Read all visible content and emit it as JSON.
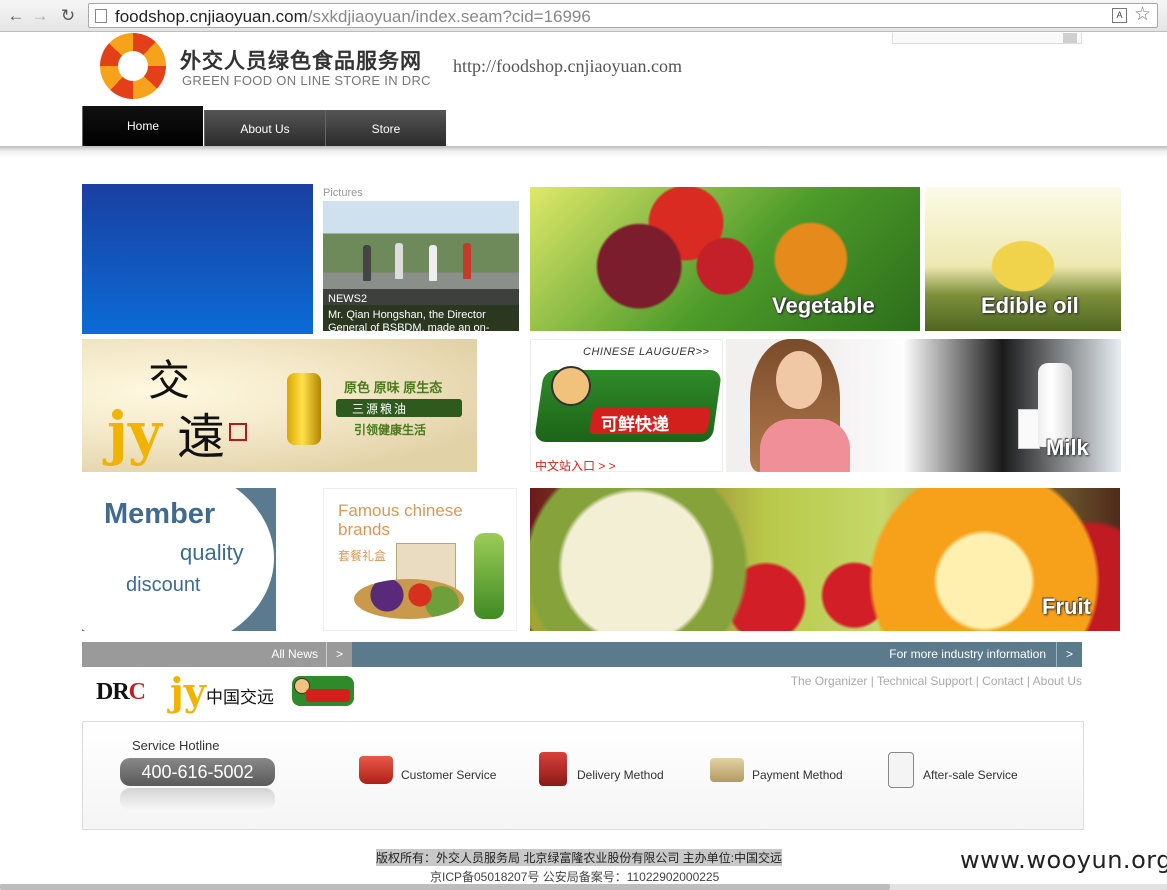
{
  "browser": {
    "url_host": "foodshop.cnjiaoyuan.com",
    "url_path": "/sxkdjiaoyuan/index.seam?cid=16996"
  },
  "header": {
    "title": "外交人员绿色食品服务网",
    "subtitle": "GREEN FOOD ON LINE STORE IN DRC",
    "site_url": "http://foodshop.cnjiaoyuan.com"
  },
  "nav": {
    "home": "Home",
    "about": "About Us",
    "store": "Store"
  },
  "tiles": {
    "pictures_label": "Pictures",
    "news_title": "NEWS2",
    "news_text": "Mr. Qian Hongshan, the Director General of BSBDM, made an on-",
    "vegetable": "Vegetable",
    "edible_oil": "Edible oil",
    "jy_char1": "交",
    "jy_char2": "遠",
    "jy_slogan1": "原色 原味 原生态",
    "jy_slogan2": "三源粮油",
    "jy_slogan3": "引领健康生活",
    "express_head": "CHINESE LAUGUER>>",
    "express_text": "可鲜快递",
    "express_link": "中文站入口 > >",
    "milk": "Milk",
    "member_1": "Member",
    "member_2": "quality",
    "member_3": "discount",
    "brands_1": "Famous chinese brands",
    "brands_2": "套餐礼盒",
    "fruit": "Fruit"
  },
  "news_bar": {
    "all_news": "All News",
    "more_info": "For more industry information",
    "arrow": ">"
  },
  "partners": {
    "drc_main": "DR",
    "drc_c": "C",
    "jy_mark": "jy",
    "cn_jy": "中国交远"
  },
  "footer_links": {
    "organizer": "The Organizer",
    "tech": "Technical Support",
    "contact": "Contact",
    "about": "About Us",
    "sep": " | "
  },
  "service": {
    "hotline_label": "Service Hotline",
    "hotline_number": "400-616-5002",
    "items": [
      "Customer Service",
      "Delivery Method",
      "Payment Method",
      "After-sale Service"
    ]
  },
  "footer": {
    "copyright": "版权所有：外交人员服务局 北京绿富隆农业股份有限公司  主办单位:中国交远",
    "icp": "京ICP备05018207号  公安局备案号：11022902000225",
    "watermark": "www.wooyun.org"
  }
}
